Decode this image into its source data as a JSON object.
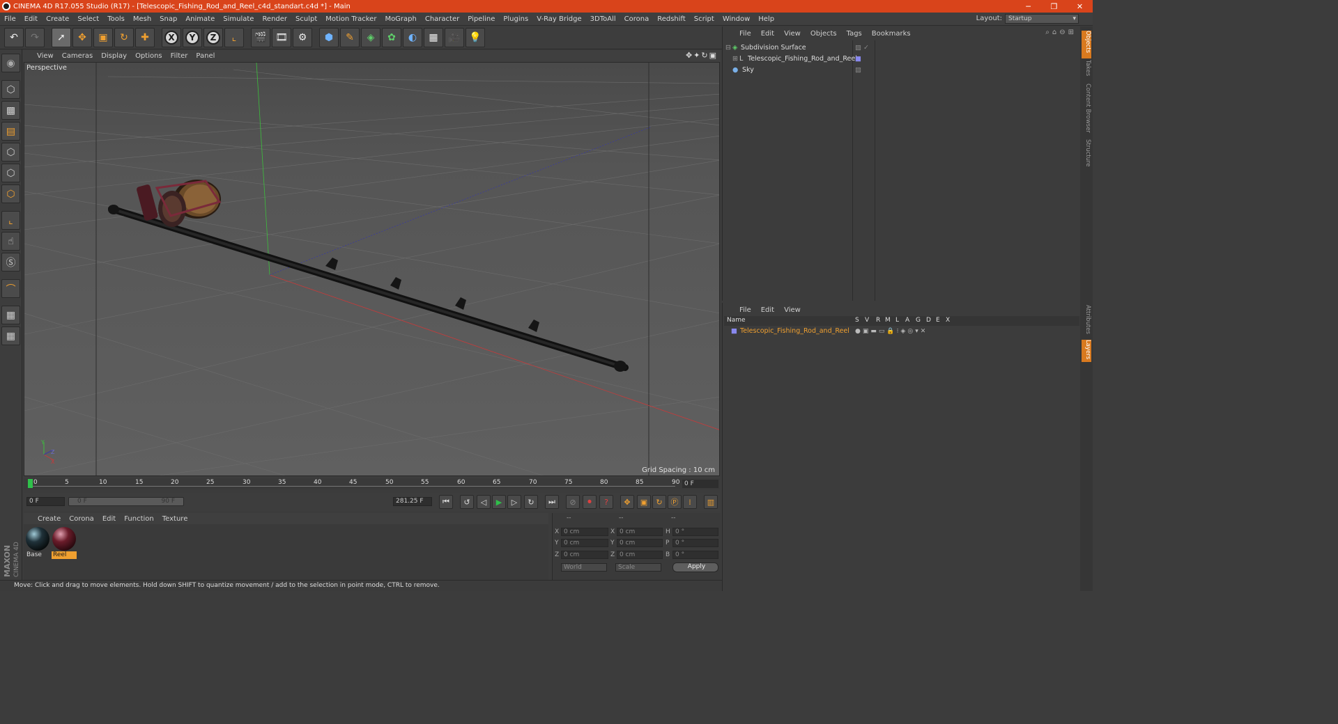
{
  "title_bar": {
    "text": "CINEMA 4D R17.055 Studio (R17) - [Telescopic_Fishing_Rod_and_Reel_c4d_standart.c4d *] - Main",
    "controls": [
      "minimize-icon",
      "restore-icon",
      "close-icon"
    ]
  },
  "menu": [
    "File",
    "Edit",
    "Create",
    "Select",
    "Tools",
    "Mesh",
    "Snap",
    "Animate",
    "Simulate",
    "Render",
    "Sculpt",
    "Motion Tracker",
    "MoGraph",
    "Character",
    "Pipeline",
    "Plugins",
    "V-Ray Bridge",
    "3DToAll",
    "Corona",
    "Redshift",
    "Script",
    "Window",
    "Help"
  ],
  "layout": {
    "label": "Layout:",
    "value": "Startup"
  },
  "toolbar": {
    "axes": [
      "X",
      "Y",
      "Z"
    ]
  },
  "viewport": {
    "menu": [
      "View",
      "Cameras",
      "Display",
      "Options",
      "Filter",
      "Panel"
    ],
    "label": "Perspective",
    "grid_spacing": "Grid Spacing : 10 cm"
  },
  "timeline": {
    "ticks": [
      "0",
      "5",
      "10",
      "15",
      "20",
      "25",
      "30",
      "35",
      "40",
      "45",
      "50",
      "55",
      "60",
      "65",
      "70",
      "75",
      "80",
      "85",
      "90"
    ],
    "current_frame": "0 F"
  },
  "playback": {
    "start": "0 F",
    "range_start": "0 F",
    "range_end": "90 F",
    "fps_field": "281.25 F"
  },
  "material_manager": {
    "menu": [
      "Create",
      "Corona",
      "Edit",
      "Function",
      "Texture"
    ],
    "materials": [
      {
        "name": "Base",
        "selected": false
      },
      {
        "name": "Reel",
        "selected": true
      }
    ]
  },
  "coordinates": {
    "headers": [
      "--",
      "--",
      "--"
    ],
    "rows": [
      {
        "a": "X",
        "av": "0 cm",
        "b": "X",
        "bv": "0 cm",
        "c": "H",
        "cv": "0 °"
      },
      {
        "a": "Y",
        "av": "0 cm",
        "b": "Y",
        "bv": "0 cm",
        "c": "P",
        "cv": "0 °"
      },
      {
        "a": "Z",
        "av": "0 cm",
        "b": "Z",
        "bv": "0 cm",
        "c": "B",
        "cv": "0 °"
      }
    ],
    "mode": "World",
    "scale": "Scale",
    "apply": "Apply"
  },
  "status": "Move: Click and drag to move elements. Hold down SHIFT to quantize movement / add to the selection in point mode, CTRL to remove.",
  "object_manager": {
    "menu": [
      "File",
      "Edit",
      "View",
      "Objects",
      "Tags",
      "Bookmarks"
    ],
    "objects": [
      {
        "name": "Subdivision Surface",
        "indent": 0
      },
      {
        "name": "Telescopic_Fishing_Rod_and_Reel",
        "indent": 1
      },
      {
        "name": "Sky",
        "indent": 0
      }
    ]
  },
  "layer_manager": {
    "menu": [
      "File",
      "Edit",
      "View"
    ],
    "columns": [
      "Name",
      "S",
      "V",
      "R",
      "M",
      "L",
      "A",
      "G",
      "D",
      "E",
      "X"
    ],
    "layers": [
      {
        "name": "Telescopic_Fishing_Rod_and_Reel"
      }
    ]
  },
  "side_tabs": [
    "Objects",
    "Takes",
    "Content Browser",
    "Structure",
    "Attributes",
    "Layers"
  ],
  "brand": "MAXON CINEMA 4D",
  "colors": {
    "title": "#d9441b",
    "accent": "#f0a030",
    "layer_name": "#f0a030"
  }
}
